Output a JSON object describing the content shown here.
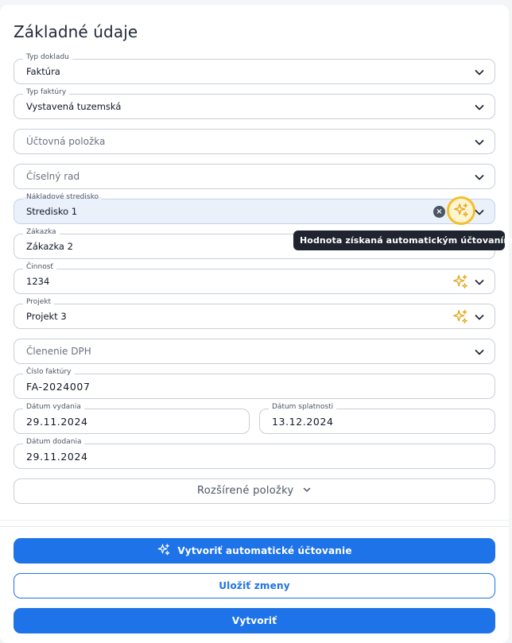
{
  "section": {
    "title": "Základné údaje"
  },
  "fields": {
    "typ_dokladu": {
      "label": "Typ dokladu",
      "value": "Faktúra"
    },
    "typ_faktury": {
      "label": "Typ faktúry",
      "value": "Vystavená tuzemská"
    },
    "uctovna_polozka": {
      "placeholder": "Účtovná položka"
    },
    "ciselny_rad": {
      "placeholder": "Číselný rad"
    },
    "nakladove_stredisko": {
      "label": "Nákladové stredisko",
      "value": "Stredisko 1"
    },
    "zakazka": {
      "label": "Zákazka",
      "value": "Zákazka 2"
    },
    "cinnost": {
      "label": "Činnosť",
      "value": "1234"
    },
    "projekt": {
      "label": "Projekt",
      "value": "Projekt 3"
    },
    "clenenie_dph": {
      "placeholder": "Členenie DPH"
    },
    "cislo_faktury": {
      "label": "Číslo faktúry",
      "value": "FA-2024007"
    },
    "datum_vydania": {
      "label": "Dátum vydania",
      "value": "29.11.2024"
    },
    "datum_splatnosti": {
      "label": "Dátum splatnosti",
      "value": "13.12.2024"
    },
    "datum_dodania": {
      "label": "Dátum dodania",
      "value": "29.11.2024"
    }
  },
  "tooltip": {
    "text": "Hodnota získaná automatickým účtovaním"
  },
  "expander": {
    "label": "Rozšírené položky"
  },
  "actions": {
    "auto_posting": "Vytvoriť automatické účtovanie",
    "save": "Uložiť zmeny",
    "create": "Vytvoriť"
  },
  "colors": {
    "primary": "#1e73e8",
    "sparkle": "#e2a91c",
    "highlight_ring": "#f5bf2a",
    "tooltip_bg": "#1f2430"
  },
  "icons": {
    "dropdown": "chevron-down-icon",
    "auto": "sparkles-icon",
    "clear": "clear-icon"
  }
}
